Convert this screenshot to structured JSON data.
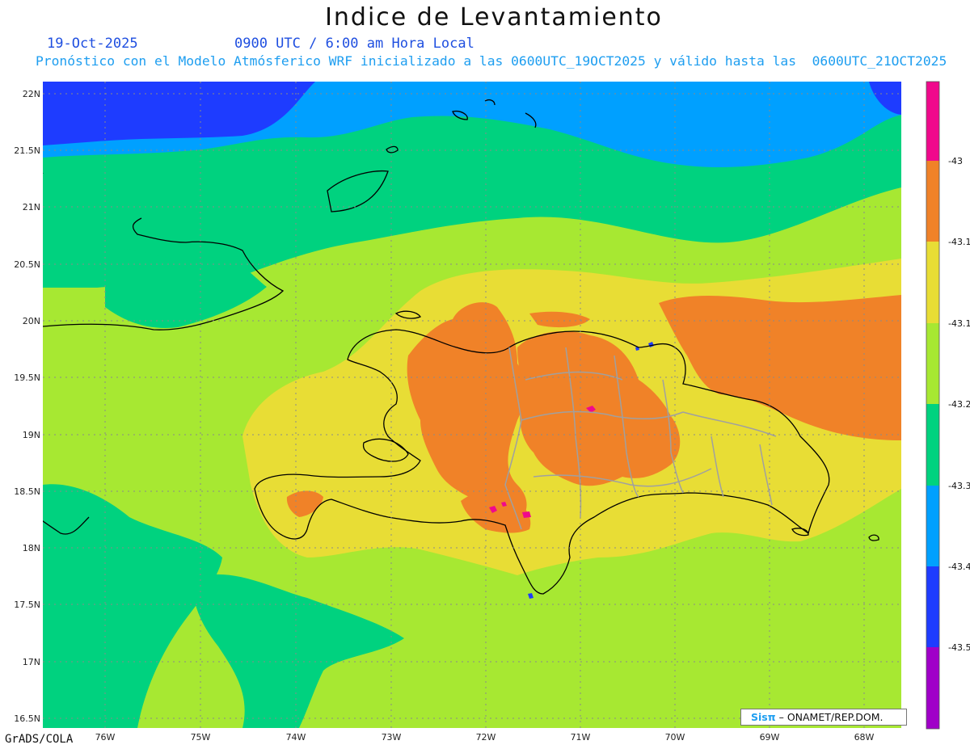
{
  "header": {
    "title": "Indice de Levantamiento",
    "date": "19-Oct-2025",
    "time": "0900 UTC / 6:00 am Hora Local",
    "forecast": "Pronóstico con el Modelo Atmósferico WRF inicializado a las 0600UTC_19OCT2025 y válido hasta las  0600UTC_21OCT2025"
  },
  "footer": {
    "software": "GrADS/COLA",
    "credit_logo": "Sisπ",
    "credit_text": " – ONAMET/REP.DOM."
  },
  "map": {
    "lat_labels": [
      "22N",
      "21.5N",
      "21N",
      "20.5N",
      "20N",
      "19.5N",
      "19N",
      "18.5N",
      "18N",
      "17.5N",
      "17N",
      "16.5N"
    ],
    "lon_labels": [
      "76W",
      "75W",
      "74W",
      "73W",
      "72W",
      "71W",
      "70W",
      "69W",
      "68W"
    ],
    "background_color": "#a7e832",
    "field_colors": {
      "dark_green": "#00d27f",
      "light_green": "#a7e832",
      "yellow": "#e8dd35",
      "orange": "#f08228",
      "magenta": "#f0098c",
      "sky_blue": "#00a0ff",
      "blue": "#1e3cff",
      "coastline": "#000000",
      "borders": "#a0a0a0"
    }
  },
  "colorbar": {
    "labels": [
      "-43",
      "-43.1",
      "-43.1",
      "-43.2",
      "-43.3",
      "-43.4",
      "-43.5"
    ],
    "colors": [
      "#f0098c",
      "#f08228",
      "#e8dd35",
      "#a7e832",
      "#00d27f",
      "#00a0ff",
      "#1e3cff",
      "#a000c8"
    ]
  }
}
